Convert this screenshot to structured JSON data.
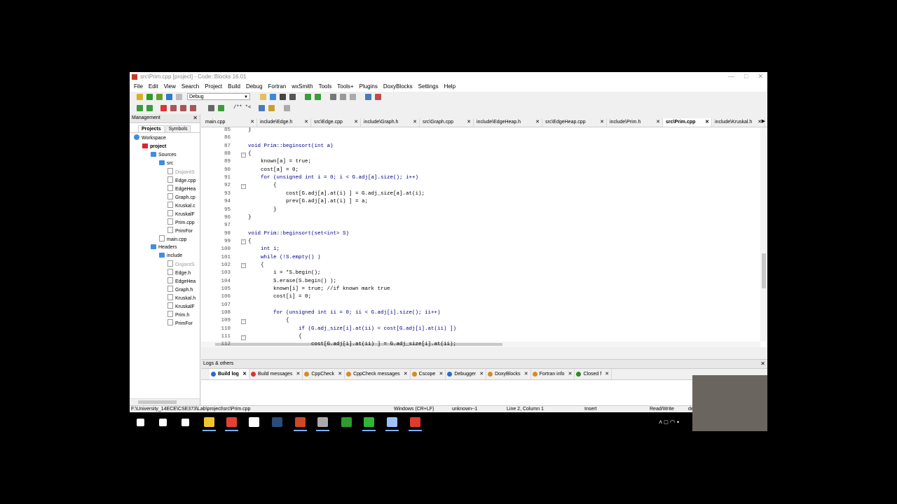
{
  "window": {
    "title": "src\\Prim.cpp [project] - Code::Blocks 16.01"
  },
  "menu": [
    "File",
    "Edit",
    "View",
    "Search",
    "Project",
    "Build",
    "Debug",
    "Fortran",
    "wxSmith",
    "Tools",
    "Tools+",
    "Plugins",
    "DoxyBlocks",
    "Settings",
    "Help"
  ],
  "toolbar": {
    "build_target": "Debug",
    "comment_label": "/** *<"
  },
  "management": {
    "title": "Management",
    "tabs": [
      "Projects",
      "Symbols"
    ],
    "tree": [
      {
        "label": "Workspace",
        "level": 0,
        "type": "workspace"
      },
      {
        "label": "project",
        "level": 1,
        "type": "project",
        "bold": true
      },
      {
        "label": "Sources",
        "level": 2,
        "type": "folder"
      },
      {
        "label": "src",
        "level": 3,
        "type": "folder"
      },
      {
        "label": "DisjointS",
        "level": 4,
        "type": "file",
        "grey": true
      },
      {
        "label": "Edge.cpp",
        "level": 4,
        "type": "file"
      },
      {
        "label": "EdgeHea",
        "level": 4,
        "type": "file"
      },
      {
        "label": "Graph.cp",
        "level": 4,
        "type": "file"
      },
      {
        "label": "Kruskal.c",
        "level": 4,
        "type": "file"
      },
      {
        "label": "KruskalF",
        "level": 4,
        "type": "file"
      },
      {
        "label": "Prim.cpp",
        "level": 4,
        "type": "file"
      },
      {
        "label": "PrimFor",
        "level": 4,
        "type": "file"
      },
      {
        "label": "main.cpp",
        "level": 3,
        "type": "file"
      },
      {
        "label": "Headers",
        "level": 2,
        "type": "folder"
      },
      {
        "label": "include",
        "level": 3,
        "type": "folder"
      },
      {
        "label": "DisjointS",
        "level": 4,
        "type": "file",
        "grey": true
      },
      {
        "label": "Edge.h",
        "level": 4,
        "type": "file"
      },
      {
        "label": "EdgeHea",
        "level": 4,
        "type": "file"
      },
      {
        "label": "Graph.h",
        "level": 4,
        "type": "file"
      },
      {
        "label": "Kruskal.h",
        "level": 4,
        "type": "file"
      },
      {
        "label": "KruskalF",
        "level": 4,
        "type": "file"
      },
      {
        "label": "Prim.h",
        "level": 4,
        "type": "file"
      },
      {
        "label": "PrimFor",
        "level": 4,
        "type": "file"
      }
    ]
  },
  "editor_tabs": [
    {
      "label": "main.cpp"
    },
    {
      "label": "include\\Edge.h"
    },
    {
      "label": "src\\Edge.cpp"
    },
    {
      "label": "include\\Graph.h"
    },
    {
      "label": "src\\Graph.cpp"
    },
    {
      "label": "include\\EdgeHeap.h"
    },
    {
      "label": "src\\EdgeHeap.cpp"
    },
    {
      "label": "include\\Prim.h"
    },
    {
      "label": "src\\Prim.cpp",
      "active": true
    },
    {
      "label": "include\\Kruskal.h"
    }
  ],
  "code_lines": [
    {
      "n": "85",
      "t": "}",
      "fold": "end"
    },
    {
      "n": "86",
      "t": ""
    },
    {
      "n": "87",
      "t": "void Prim::beginsort(int a)"
    },
    {
      "n": "88",
      "t": "{",
      "fold": "open"
    },
    {
      "n": "89",
      "t": "    known[a] = true;"
    },
    {
      "n": "90",
      "t": "    cost[a] = 0;"
    },
    {
      "n": "91",
      "t": "    for (unsigned int i = 0; i < G.adj[a].size(); i++)"
    },
    {
      "n": "92",
      "t": "        {",
      "fold": "open"
    },
    {
      "n": "93",
      "t": "            cost[G.adj[a].at(i) ] = G.adj_size[a].at(i);"
    },
    {
      "n": "94",
      "t": "            prev[G.adj[a].at(i) ] = a;"
    },
    {
      "n": "95",
      "t": "        }"
    },
    {
      "n": "96",
      "t": "}"
    },
    {
      "n": "97",
      "t": ""
    },
    {
      "n": "98",
      "t": "void Prim::beginsort(set<int> S)"
    },
    {
      "n": "99",
      "t": "{",
      "fold": "open"
    },
    {
      "n": "100",
      "t": "    int i;"
    },
    {
      "n": "101",
      "t": "    while (!S.empty() )"
    },
    {
      "n": "102",
      "t": "    {",
      "fold": "open"
    },
    {
      "n": "103",
      "t": "        i = *S.begin();"
    },
    {
      "n": "104",
      "t": "        S.erase(S.begin() );"
    },
    {
      "n": "105",
      "t": "        known[i] = true; //if known mark true"
    },
    {
      "n": "106",
      "t": "        cost[i] = 0;"
    },
    {
      "n": "107",
      "t": ""
    },
    {
      "n": "108",
      "t": "        for (unsigned int ii = 0; ii < G.adj[i].size(); ii++)"
    },
    {
      "n": "109",
      "t": "            {",
      "fold": "open"
    },
    {
      "n": "110",
      "t": "                if (G.adj_size[i].at(ii) < cost[G.adj[i].at(ii) ])"
    },
    {
      "n": "111",
      "t": "                {",
      "fold": "open"
    },
    {
      "n": "112",
      "t": "                    cost[G.adj[i].at(ii) ] = G.adj_size[i].at(ii);"
    }
  ],
  "logs": {
    "title": "Logs & others",
    "tabs": [
      {
        "label": "Build log",
        "active": true,
        "color": "#2a6ad0"
      },
      {
        "label": "Build messages",
        "color": "#d33"
      },
      {
        "label": "CppCheck",
        "color": "#d88a22"
      },
      {
        "label": "CppCheck messages",
        "color": "#d88a22"
      },
      {
        "label": "Cscope",
        "color": "#d88a22"
      },
      {
        "label": "Debugger",
        "color": "#2a6ad0"
      },
      {
        "label": "DoxyBlocks",
        "color": "#d88a22"
      },
      {
        "label": "Fortran info",
        "color": "#d88a22"
      },
      {
        "label": "Closed f",
        "color": "#2a8a2a"
      }
    ]
  },
  "status": {
    "path": "F:\\University_14ECE\\CSE373\\Lab\\project\\src\\Prim.cpp",
    "eol": "Windows (CR+LF)",
    "encoding": "unknown--1",
    "position": "Line 2, Column 1",
    "mode": "Insert",
    "access": "Read/Write",
    "extra": "de"
  },
  "taskbar": [
    {
      "name": "windows-start-icon",
      "color": "#ffffff"
    },
    {
      "name": "search-icon",
      "color": "#ffffff"
    },
    {
      "name": "task-view-icon",
      "color": "#ffffff"
    },
    {
      "name": "file-explorer-icon",
      "color": "#f2c530",
      "active": true
    },
    {
      "name": "chrome-icon",
      "color": "#e44134",
      "active": true
    },
    {
      "name": "store-icon",
      "color": "#ffffff"
    },
    {
      "name": "steam-icon",
      "color": "#2a4c7a"
    },
    {
      "name": "powerpoint-icon",
      "color": "#d24726",
      "active": true
    },
    {
      "name": "app-icon",
      "color": "#aaaaaa",
      "active": true
    },
    {
      "name": "paint-icon",
      "color": "#2d9d2d"
    },
    {
      "name": "camtasia-icon",
      "color": "#33b533",
      "active": true
    },
    {
      "name": "notes-icon",
      "color": "#9ec0ff",
      "active": true
    },
    {
      "name": "codeblocks-icon",
      "color": "#e03a2a",
      "active": true
    }
  ]
}
